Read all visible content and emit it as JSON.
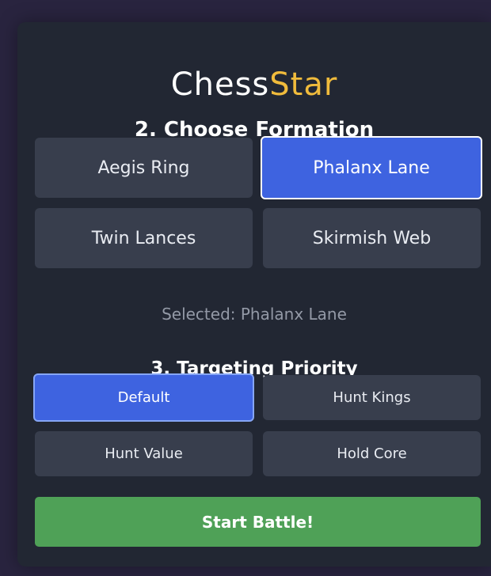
{
  "logo": {
    "part1": "Chess",
    "part2": "Star"
  },
  "formation": {
    "heading": "2. Choose Formation",
    "options": [
      "Aegis Ring",
      "Phalanx Lane",
      "Twin Lances",
      "Skirmish Web"
    ],
    "selected_index": 1,
    "selected_label": "Selected: Phalanx Lane"
  },
  "targeting": {
    "heading": "3. Targeting Priority",
    "options": [
      "Default",
      "Hunt Kings",
      "Hunt Value",
      "Hold Core"
    ],
    "selected_index": 0
  },
  "start_button": {
    "label": "Start Battle!"
  },
  "colors": {
    "background": "#29243f",
    "panel": "#222733",
    "button": "#383e4d",
    "selected": "#3e63e0",
    "accent_star": "#f0bb3c",
    "start": "#4fa157"
  }
}
